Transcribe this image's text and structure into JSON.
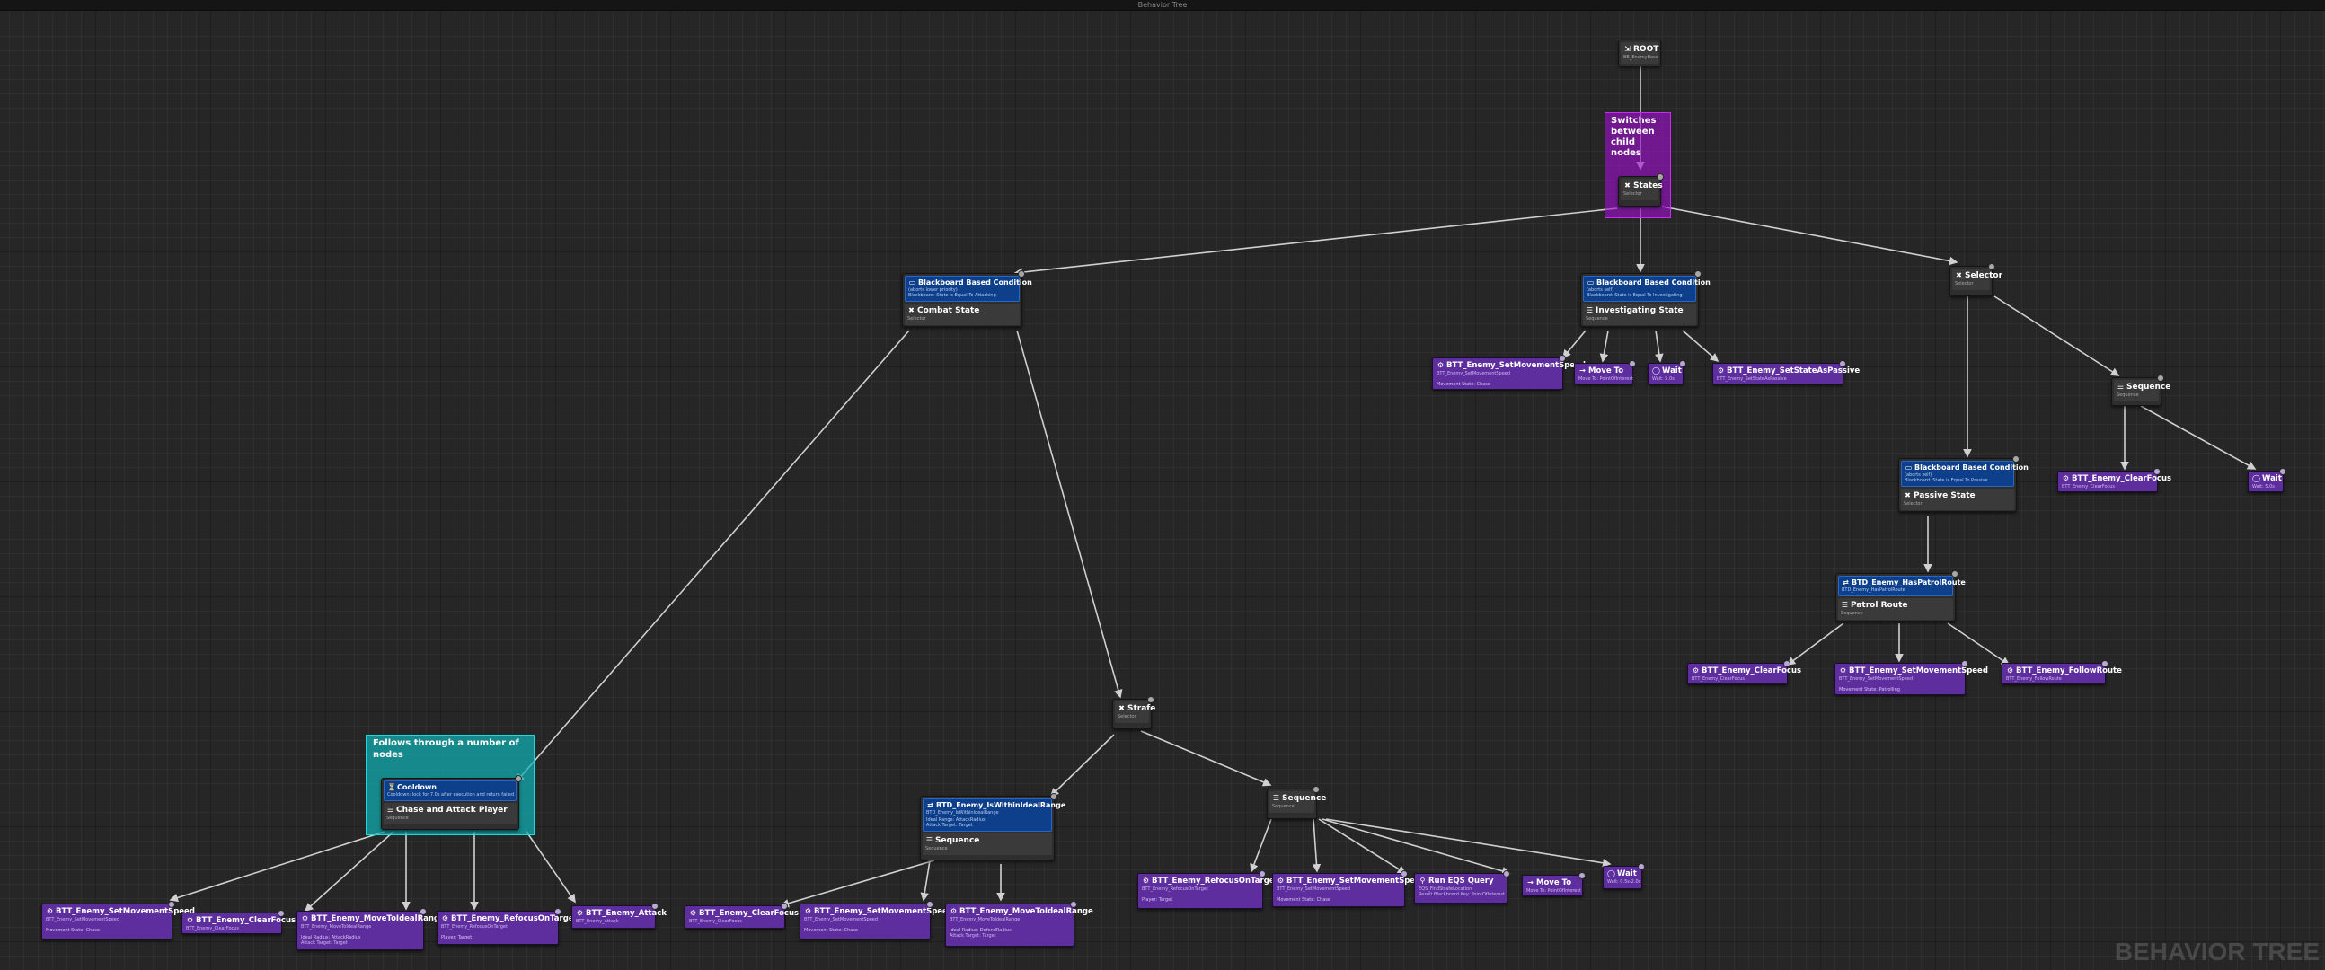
{
  "window": {
    "title": "Behavior Tree",
    "watermark": "BEHAVIOR TREE"
  },
  "colors": {
    "composite": "#3a3a3a",
    "decorator": "#0d3f8a",
    "task": "#5e2e9e",
    "comment_purple": "#a010d0",
    "comment_teal": "#0fb3b8",
    "wire": "#d0d0d0"
  },
  "icons": {
    "root": "root-icon",
    "selector": "selector-icon",
    "sequence": "sequence-icon",
    "decorator": "blackboard-icon",
    "task": "task-icon",
    "wait": "wait-icon",
    "move": "move-icon",
    "eqs": "eqs-icon",
    "cooldown": "cooldown-icon"
  },
  "comments": {
    "selector_comment": "Switches between child nodes",
    "sequence_comment": "Follows through a number of nodes"
  },
  "nodes": {
    "root": {
      "title": "ROOT",
      "sub": "BB_EnemyBase"
    },
    "states": {
      "title": "States",
      "sub": "Selector"
    },
    "combat": {
      "decorator_title": "Blackboard Based Condition",
      "decorator_sub": "(aborts lower priority)",
      "decorator_detail": "Blackboard: State is Equal To Attacking",
      "title": "Combat State",
      "sub": "Selector"
    },
    "investigating": {
      "decorator_title": "Blackboard Based Condition",
      "decorator_sub": "(aborts self)",
      "decorator_detail": "Blackboard: State is Equal To Investigating",
      "title": "Investigating State",
      "sub": "Sequence"
    },
    "selector_right": {
      "title": "Selector",
      "sub": "Selector"
    },
    "sequence_right": {
      "title": "Sequence",
      "sub": "Sequence"
    },
    "passive": {
      "decorator_title": "Blackboard Based Condition",
      "decorator_sub": "(aborts self)",
      "decorator_detail": "Blackboard: State is Equal To Passive",
      "title": "Passive State",
      "sub": "Selector"
    },
    "patrol": {
      "decorator_title": "BTD_Enemy_HasPatrolRoute",
      "decorator_sub": "BTD_Enemy_HasPatrolRoute",
      "title": "Patrol Route",
      "sub": "Sequence"
    },
    "strafe": {
      "title": "Strafe",
      "sub": "Selector"
    },
    "sequence_strafe": {
      "title": "Sequence",
      "sub": "Sequence"
    },
    "ideal_range": {
      "decorator_title": "BTD_Enemy_IsWithinIdealRange",
      "decorator_sub": "BTD_Enemy_IsWithinIdealRange",
      "decorator_detail": "Ideal Range: AttackRadius",
      "decorator_detail2": "Attack Target: Target",
      "title": "Sequence",
      "sub": "Sequence"
    },
    "chase": {
      "decorator_title": "Cooldown",
      "decorator_sub": "Cooldown: lock for 7.0s after execution and return failed",
      "title": "Chase and Attack Player",
      "sub": "Sequence"
    }
  },
  "tasks": {
    "inv_speed": {
      "title": "BTT_Enemy_SetMovementSpeed",
      "sub": "BTT_Enemy_SetMovementSpeed",
      "detail": "Movement State: Chase"
    },
    "inv_move": {
      "title": "Move To",
      "sub": "Move To: PointOfInterest"
    },
    "inv_wait": {
      "title": "Wait",
      "sub": "Wait: 5.0s"
    },
    "inv_passive": {
      "title": "BTT_Enemy_SetStateAsPassive",
      "sub": "BTT_Enemy_SetStateAsPassive"
    },
    "seq_clearfocus": {
      "title": "BTT_Enemy_ClearFocus",
      "sub": "BTT_Enemy_ClearFocus"
    },
    "seq_wait": {
      "title": "Wait",
      "sub": "Wait: 5.0s"
    },
    "pat_clearfocus": {
      "title": "BTT_Enemy_ClearFocus",
      "sub": "BTT_Enemy_ClearFocus"
    },
    "pat_speed": {
      "title": "BTT_Enemy_SetMovementSpeed",
      "sub": "BTT_Enemy_SetMovementSpeed",
      "detail": "Movement State: Patrolling"
    },
    "pat_follow": {
      "title": "BTT_Enemy_FollowRoute",
      "sub": "BTT_Enemy_FollowRoute"
    },
    "ch_speed": {
      "title": "BTT_Enemy_SetMovementSpeed",
      "sub": "BTT_Enemy_SetMovementSpeed",
      "detail": "Movement State: Chase"
    },
    "ch_clearfocus": {
      "title": "BTT_Enemy_ClearFocus",
      "sub": "BTT_Enemy_ClearFocus"
    },
    "ch_moveideal": {
      "title": "BTT_Enemy_MoveToIdealRange",
      "sub": "BTT_Enemy_MoveToIdealRange",
      "detail": "Ideal Radius: AttackRadius",
      "detail2": "Attack Target: Target"
    },
    "ch_refocus": {
      "title": "BTT_Enemy_RefocusOnTarget",
      "sub": "BTT_Enemy_RefocusOnTarget",
      "detail": "Player: Target"
    },
    "ch_attack": {
      "title": "BTT_Enemy_Attack",
      "sub": "BTT_Enemy_Attack"
    },
    "ir_clearfocus": {
      "title": "BTT_Enemy_ClearFocus",
      "sub": "BTT_Enemy_ClearFocus"
    },
    "ir_speed": {
      "title": "BTT_Enemy_SetMovementSpeed",
      "sub": "BTT_Enemy_SetMovementSpeed",
      "detail": "Movement State: Chase"
    },
    "ir_moveideal": {
      "title": "BTT_Enemy_MoveToIdealRange",
      "sub": "BTT_Enemy_MoveToIdealRange",
      "detail": "Ideal Radius: DefendRadius",
      "detail2": "Attack Target: Target"
    },
    "st_refocus": {
      "title": "BTT_Enemy_RefocusOnTarget",
      "sub": "BTT_Enemy_RefocusOnTarget",
      "detail": "Player: Target"
    },
    "st_speed": {
      "title": "BTT_Enemy_SetMovementSpeed",
      "sub": "BTT_Enemy_SetMovementSpeed",
      "detail": "Movement State: Chase"
    },
    "st_eqs": {
      "title": "Run EQS Query",
      "sub": "EQS_FindStrafeLocation",
      "detail": "Result Blackboard Key: PointOfInterest"
    },
    "st_move": {
      "title": "Move To",
      "sub": "Move To: PointOfInterest"
    },
    "st_wait": {
      "title": "Wait",
      "sub": "Wait: 0.5s-2.0s"
    }
  }
}
